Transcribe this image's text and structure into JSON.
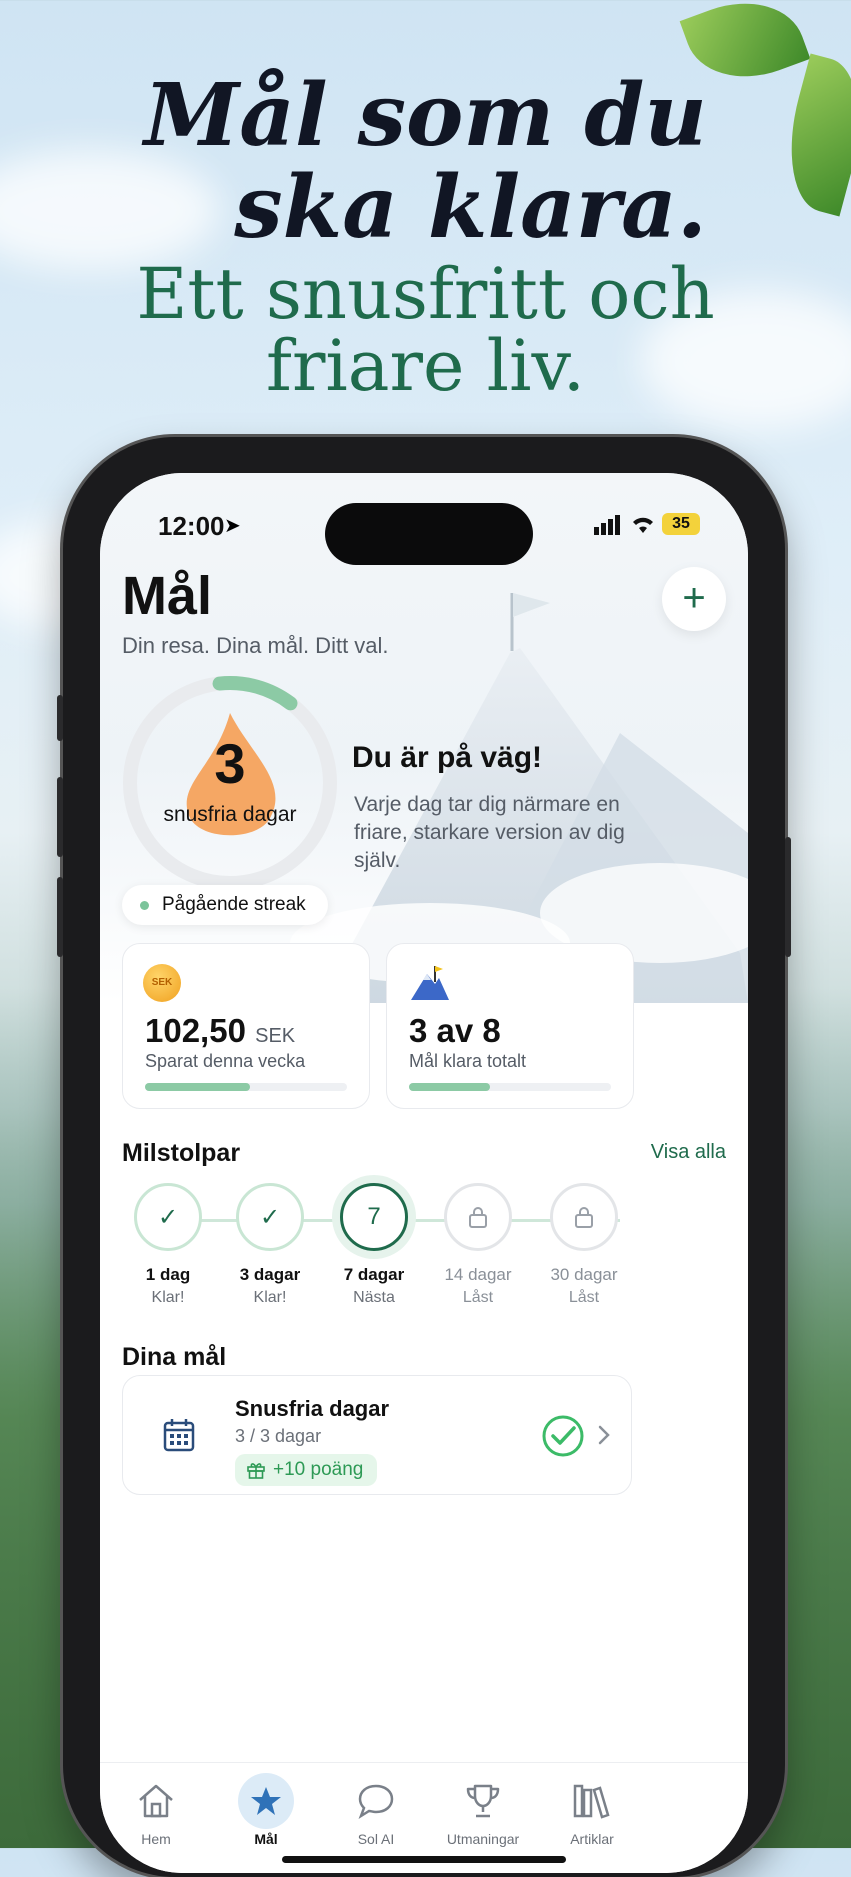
{
  "hero": {
    "line1a": "Mål som du",
    "line1b": "ska klara.",
    "line2a": "Ett snusfritt och",
    "line2b": "friare liv."
  },
  "status_bar": {
    "time": "12:00",
    "battery": "35"
  },
  "page": {
    "title": "Mål",
    "subtitle": "Din resa. Dina mål. Ditt val."
  },
  "streak": {
    "days": "3",
    "label": "snusfria dagar",
    "pill": "Pågående streak",
    "progress_fraction": 0.12
  },
  "encouragement": {
    "headline": "Du är på väg!",
    "body": "Varje dag tar dig närmare en friare, starkare version av dig själv."
  },
  "stats": [
    {
      "icon": "coin-icon",
      "coin_text": "SEK",
      "value": "102,50",
      "unit": "SEK",
      "label": "Sparat denna vecka",
      "progress": 0.52
    },
    {
      "icon": "mountain-flag-icon",
      "value": "3 av 8",
      "unit": "",
      "label": "Mål klara totalt",
      "progress": 0.4
    }
  ],
  "milestones": {
    "title": "Milstolpar",
    "see_all": "Visa alla",
    "items": [
      {
        "label": "1 dag",
        "status": "Klar!",
        "state": "done"
      },
      {
        "label": "3 dagar",
        "status": "Klar!",
        "state": "done"
      },
      {
        "label": "7 dagar",
        "status": "Nästa",
        "state": "next",
        "badge": "7"
      },
      {
        "label": "14 dagar",
        "status": "Låst",
        "state": "locked"
      },
      {
        "label": "30 dagar",
        "status": "Låst",
        "state": "locked"
      }
    ]
  },
  "goals": {
    "title": "Dina mål",
    "items": [
      {
        "title": "Snusfria dagar",
        "progress": "3 / 3 dagar",
        "reward": "+10 poäng",
        "completed": true
      }
    ]
  },
  "tabbar": [
    {
      "label": "Hem",
      "icon": "home-icon"
    },
    {
      "label": "Mål",
      "icon": "star-icon",
      "active": true
    },
    {
      "label": "Sol AI",
      "icon": "chat-bubble-icon"
    },
    {
      "label": "Utmaningar",
      "icon": "trophy-icon"
    },
    {
      "label": "Artiklar",
      "icon": "books-icon"
    }
  ],
  "colors": {
    "brand_green": "#1f6b4c",
    "accent_light_green": "#8ccaa5",
    "success_green": "#2d9a55"
  }
}
